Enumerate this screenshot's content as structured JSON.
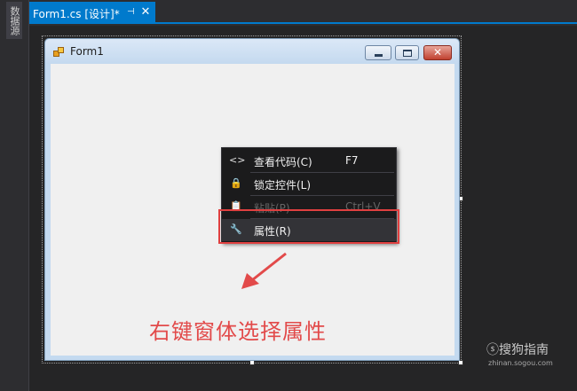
{
  "side_panel": {
    "tab_label": "数据源"
  },
  "document_tab": {
    "title": "Form1.cs [设计]*",
    "pin_glyph": "⊣",
    "close_glyph": "✕"
  },
  "form": {
    "title": "Form1",
    "minimize_glyph": "",
    "maximize_glyph": "",
    "close_glyph": "✕"
  },
  "context_menu": {
    "items": [
      {
        "icon": "code-icon",
        "glyph": "<>",
        "label": "查看代码(C)",
        "shortcut": "F7",
        "enabled": true
      },
      {
        "icon": "lock-icon",
        "glyph": "🔒",
        "label": "锁定控件(L)",
        "shortcut": "",
        "enabled": true
      },
      {
        "icon": "paste-icon",
        "glyph": "📋",
        "label": "粘贴(P)",
        "shortcut": "Ctrl+V",
        "enabled": false
      },
      {
        "icon": "wrench-icon",
        "glyph": "🔧",
        "label": "属性(R)",
        "shortcut": "",
        "enabled": true,
        "highlighted": true
      }
    ]
  },
  "annotation": {
    "text": "右键窗体选择属性",
    "color": "#e24a4a"
  },
  "watermark": {
    "logo_text": "ⓢ搜狗指南",
    "url": "zhinan.sogou.com"
  },
  "colors": {
    "accent": "#007acc",
    "ide_background": "#2d2d30",
    "highlight": "#e04040"
  }
}
